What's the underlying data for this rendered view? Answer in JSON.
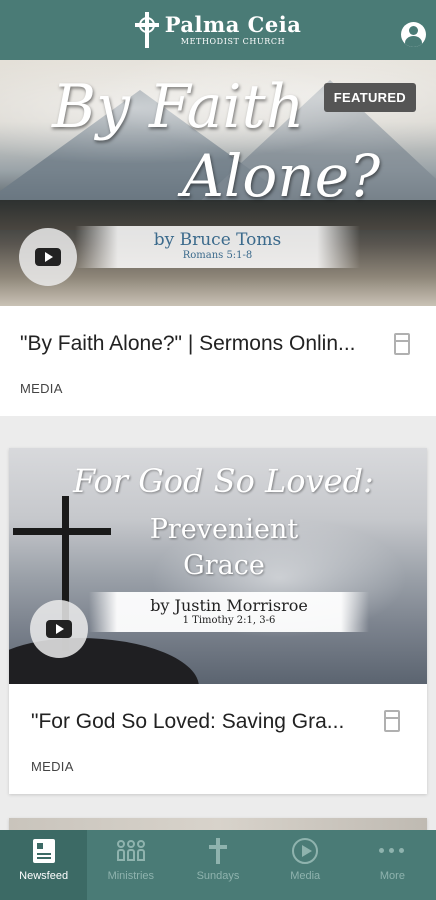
{
  "header": {
    "church_name": "Palma Ceia",
    "church_subtitle": "METHODIST CHURCH",
    "logo_icon": "cross-icon",
    "profile_icon": "user-profile-icon"
  },
  "featured": {
    "badge": "FEATURED",
    "thumb_title_line1": "By Faith",
    "thumb_title_line2": "Alone?",
    "thumb_speaker": "by Bruce Toms",
    "thumb_reference": "Romans 5:1-8",
    "title": "\"By Faith Alone?\" | Sermons Onlin...",
    "category": "MEDIA"
  },
  "cards": [
    {
      "thumb_title": "For God So Loved:",
      "thumb_subtitle_line1": "Prevenient",
      "thumb_subtitle_line2": "Grace",
      "thumb_speaker": "by Justin Morrisroe",
      "thumb_reference": "1 Timothy 2:1, 3-6",
      "title": "\"For God So Loved: Saving Gra...",
      "category": "MEDIA"
    }
  ],
  "bottom_nav": {
    "items": [
      {
        "label": "Newsfeed",
        "icon": "newsfeed-icon",
        "active": true
      },
      {
        "label": "Ministries",
        "icon": "people-icon",
        "active": false
      },
      {
        "label": "Sundays",
        "icon": "cross-icon",
        "active": false
      },
      {
        "label": "Media",
        "icon": "play-circle-icon",
        "active": false
      },
      {
        "label": "More",
        "icon": "more-dots-icon",
        "active": false
      }
    ]
  },
  "colors": {
    "brand": "#4a7b76",
    "brand_active": "#3c6a65",
    "nav_inactive": "#8fb3ae"
  }
}
